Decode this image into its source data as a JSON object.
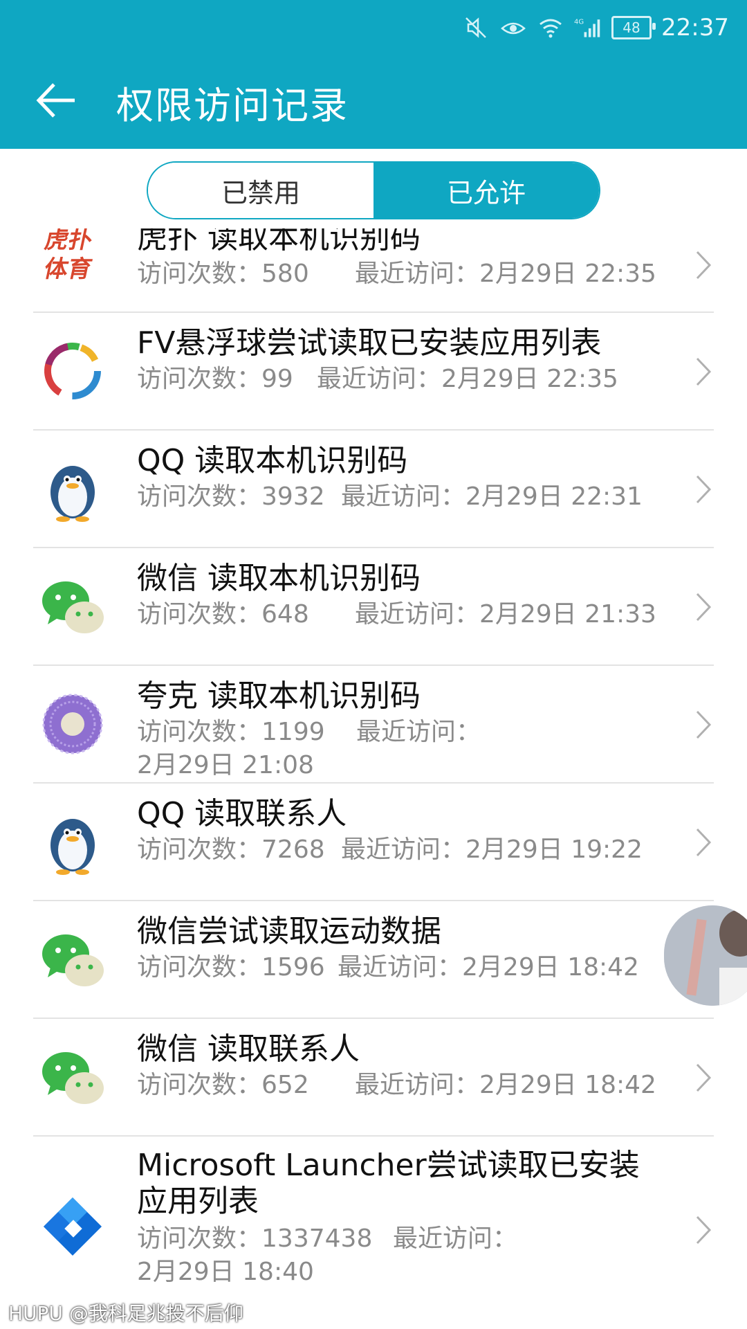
{
  "status_bar": {
    "battery": "48",
    "time": "22:37"
  },
  "header": {
    "title": "权限访问记录"
  },
  "segments": [
    {
      "label": "已禁用",
      "active": false
    },
    {
      "label": "已允许",
      "active": true
    }
  ],
  "records": [
    {
      "app_icon": "hupu-icon",
      "title": "虎扑  读取本机识别码",
      "count_label": "访问次数：",
      "count": "580",
      "recent_label": "最近访问：",
      "recent": "2月29日  22:35"
    },
    {
      "app_icon": "fv-ball-icon",
      "title": "FV悬浮球尝试读取已安装应用列表",
      "count_label": "访问次数：",
      "count": "99",
      "recent_label": "最近访问：",
      "recent": "2月29日  22:35"
    },
    {
      "app_icon": "qq-icon",
      "title": "QQ  读取本机识别码",
      "count_label": "访问次数：",
      "count": "3932",
      "recent_label": "最近访问：",
      "recent": "2月29日  22:31"
    },
    {
      "app_icon": "wechat-icon",
      "title": "微信  读取本机识别码",
      "count_label": "访问次数：",
      "count": "648",
      "recent_label": "最近访问：",
      "recent": "2月29日  21:33"
    },
    {
      "app_icon": "quark-icon",
      "title": "夸克  读取本机识别码",
      "count_label": "访问次数：",
      "count": "1199",
      "recent_label": "最近访问：",
      "recent": "2月29日  21:08"
    },
    {
      "app_icon": "qq-icon",
      "title": "QQ  读取联系人",
      "count_label": "访问次数：",
      "count": "7268",
      "recent_label": "最近访问：",
      "recent": "2月29日  19:22"
    },
    {
      "app_icon": "wechat-icon",
      "title": "微信尝试读取运动数据",
      "count_label": "访问次数：",
      "count": "1596",
      "recent_label": "最近访问：",
      "recent": "2月29日  18:42"
    },
    {
      "app_icon": "wechat-icon",
      "title": "微信  读取联系人",
      "count_label": "访问次数：",
      "count": "652",
      "recent_label": "最近访问：",
      "recent": "2月29日  18:42"
    },
    {
      "app_icon": "microsoft-launcher-icon",
      "title": "Microsoft  Launcher尝试读取已安装应用列表",
      "count_label": "访问次数：",
      "count": "1337438",
      "recent_label": "最近访问：",
      "recent": "2月29日  18:40"
    }
  ],
  "watermark": "HUPU @我科足兆投不后仰",
  "colors": {
    "accent": "#0fa7c2"
  }
}
